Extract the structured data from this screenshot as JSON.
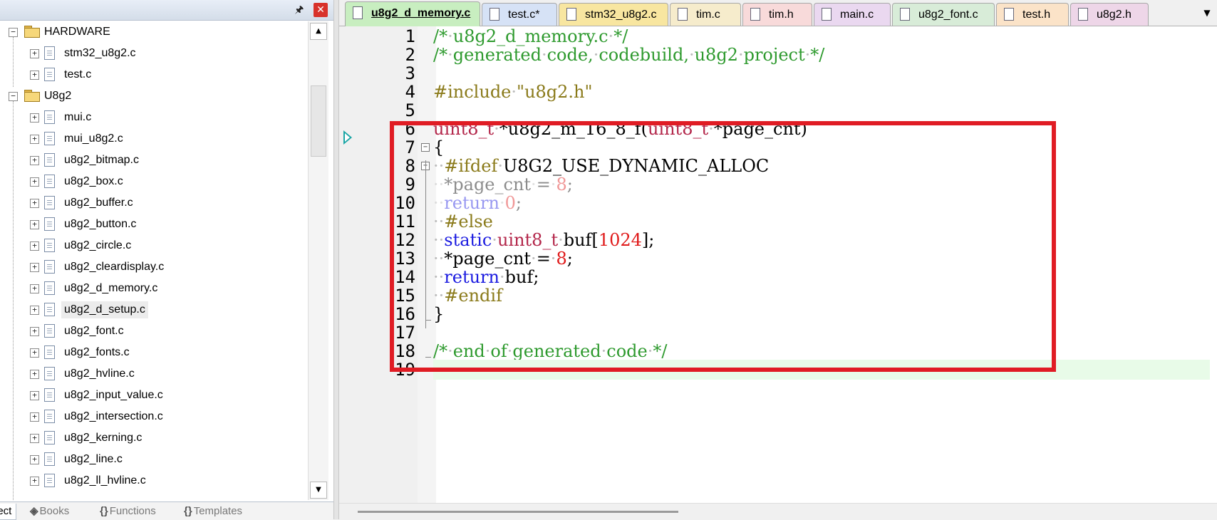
{
  "project_pane": {
    "pin_icon": "pin-icon",
    "close_icon": "close-icon",
    "tree": [
      {
        "label": "HARDWARE",
        "kind": "folder",
        "expanded": true
      },
      {
        "label": "stm32_u8g2.c",
        "kind": "file"
      },
      {
        "label": "test.c",
        "kind": "file"
      },
      {
        "label": "U8g2",
        "kind": "folder",
        "expanded": true
      },
      {
        "label": "mui.c",
        "kind": "file"
      },
      {
        "label": "mui_u8g2.c",
        "kind": "file"
      },
      {
        "label": "u8g2_bitmap.c",
        "kind": "file"
      },
      {
        "label": "u8g2_box.c",
        "kind": "file"
      },
      {
        "label": "u8g2_buffer.c",
        "kind": "file"
      },
      {
        "label": "u8g2_button.c",
        "kind": "file"
      },
      {
        "label": "u8g2_circle.c",
        "kind": "file"
      },
      {
        "label": "u8g2_cleardisplay.c",
        "kind": "file"
      },
      {
        "label": "u8g2_d_memory.c",
        "kind": "file"
      },
      {
        "label": "u8g2_d_setup.c",
        "kind": "file",
        "selected": true
      },
      {
        "label": "u8g2_font.c",
        "kind": "file"
      },
      {
        "label": "u8g2_fonts.c",
        "kind": "file"
      },
      {
        "label": "u8g2_hvline.c",
        "kind": "file"
      },
      {
        "label": "u8g2_input_value.c",
        "kind": "file"
      },
      {
        "label": "u8g2_intersection.c",
        "kind": "file"
      },
      {
        "label": "u8g2_kerning.c",
        "kind": "file"
      },
      {
        "label": "u8g2_line.c",
        "kind": "file"
      },
      {
        "label": "u8g2_ll_hvline.c",
        "kind": "file"
      }
    ],
    "bottom_tabs": {
      "project": "ject",
      "books": "Books",
      "functions": "Functions",
      "templates": "Templates"
    }
  },
  "editor": {
    "tabs": [
      {
        "label": "u8g2_d_memory.c",
        "color": "#c8eec0",
        "active": true
      },
      {
        "label": "test.c*",
        "color": "#d6e2f6"
      },
      {
        "label": "stm32_u8g2.c",
        "color": "#f8e6a0"
      },
      {
        "label": "tim.c",
        "color": "#f6eccc"
      },
      {
        "label": "tim.h",
        "color": "#f8dada"
      },
      {
        "label": "main.c",
        "color": "#ead8f0"
      },
      {
        "label": "u8g2_font.c",
        "color": "#d8ecd8"
      },
      {
        "label": "test.h",
        "color": "#fbe3c8"
      },
      {
        "label": "u8g2.h",
        "color": "#eed6e8"
      }
    ],
    "line_numbers": [
      "1",
      "2",
      "3",
      "4",
      "5",
      "6",
      "7",
      "8",
      "9",
      "10",
      "11",
      "12",
      "13",
      "14",
      "15",
      "16",
      "17",
      "18",
      "19"
    ],
    "current_line": 19,
    "highlight_color": "#e01c24"
  }
}
